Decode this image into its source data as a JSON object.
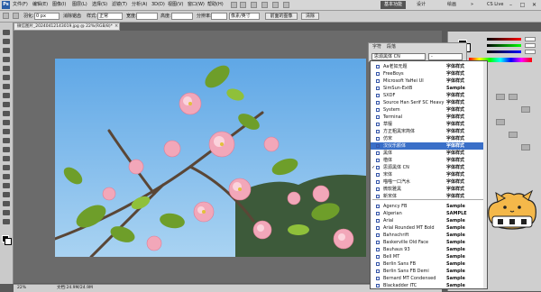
{
  "app": {
    "logo_text": "Ps"
  },
  "menu": [
    "文件(F)",
    "编辑(E)",
    "图像(I)",
    "图层(L)",
    "选择(S)",
    "滤镜(T)",
    "分析(A)",
    "3D(D)",
    "视图(V)",
    "窗口(W)",
    "帮助(H)"
  ],
  "workspace": {
    "essentials": "基本功能",
    "design": "设计",
    "painting": "绘画",
    "more": "»",
    "cs_live": "CS Live"
  },
  "window_controls": {
    "minimize": "–",
    "maximize": "□",
    "close": "✕"
  },
  "options_bar": {
    "feather_label": "羽化:",
    "feather_value": "0 px",
    "antialias_label": "消除锯齿",
    "style_label": "样式:",
    "style_value": "正常",
    "width_label": "宽度:",
    "height_label": "高度:",
    "resolution_label": "分辨率:",
    "resolution_value": "像素/英寸",
    "front_image_button": "前面的图像",
    "clear_button": "清除"
  },
  "document": {
    "tab_title": "微信图片_20240412143019.jpg @ 22%(RGB/8)*",
    "zoom": "22%",
    "doc_size": "文档:24.9M/24.9M"
  },
  "character_panel": {
    "tabs": [
      "字符",
      "段落"
    ],
    "font_family": "思源黑体 CN",
    "font_style": "-"
  },
  "font_list": {
    "recent": [
      {
        "name": "Aa老如无题",
        "sample": "字体样式",
        "checked": false
      },
      {
        "name": "FreeBoys",
        "sample": "字体样式",
        "checked": false
      },
      {
        "name": "Microsoft YaHei UI",
        "sample": "字体样式",
        "checked": false
      },
      {
        "name": "SimSun-ExtB",
        "sample": "Sample",
        "checked": false
      },
      {
        "name": "SXDF",
        "sample": "字体样式",
        "checked": false
      },
      {
        "name": "Source Han Serif SC Heavy",
        "sample": "字体样式",
        "checked": false
      },
      {
        "name": "System",
        "sample": "字体样式",
        "checked": false
      },
      {
        "name": "Terminal",
        "sample": "字体样式",
        "checked": false
      },
      {
        "name": "草檀",
        "sample": "字体样式",
        "checked": false
      },
      {
        "name": "方正粗黑宋简体",
        "sample": "字体样式",
        "checked": false
      },
      {
        "name": "仿宋",
        "sample": "字体样式",
        "checked": false
      },
      {
        "name": "汉仪乐颜体",
        "sample": "字体样式",
        "checked": false,
        "selected": true
      },
      {
        "name": "黑体",
        "sample": "字体样式",
        "checked": false
      },
      {
        "name": "楷体",
        "sample": "字体样式",
        "checked": false
      },
      {
        "name": "思源黑体 CN",
        "sample": "字体样式",
        "checked": true
      },
      {
        "name": "宋体",
        "sample": "字体样式",
        "checked": false
      },
      {
        "name": "喵喵一口汽水",
        "sample": "字体样式",
        "checked": false
      },
      {
        "name": "微软雅黑",
        "sample": "字体样式",
        "checked": false
      },
      {
        "name": "新宋体",
        "sample": "字体样式",
        "checked": false
      }
    ],
    "all": [
      {
        "name": "Agency FB",
        "sample": "Sample"
      },
      {
        "name": "Algerian",
        "sample": "SAMPLE"
      },
      {
        "name": "Arial",
        "sample": "Sample"
      },
      {
        "name": "Arial Rounded MT Bold",
        "sample": "Sample"
      },
      {
        "name": "Bahnschrift",
        "sample": "Sample"
      },
      {
        "name": "Baskerville Old Face",
        "sample": "Sample"
      },
      {
        "name": "Bauhaus 93",
        "sample": "Sample"
      },
      {
        "name": "Bell MT",
        "sample": "Sample"
      },
      {
        "name": "Berlin Sans FB",
        "sample": "Sample"
      },
      {
        "name": "Berlin Sans FB Demi",
        "sample": "Sample"
      },
      {
        "name": "Bernard MT Condensed",
        "sample": "Sample"
      },
      {
        "name": "Blackadder ITC",
        "sample": "Sample"
      }
    ]
  },
  "colors": {
    "selection": "#3a6fc8",
    "sky": "#7ab8e8",
    "blossom": "#f0a6b8"
  }
}
